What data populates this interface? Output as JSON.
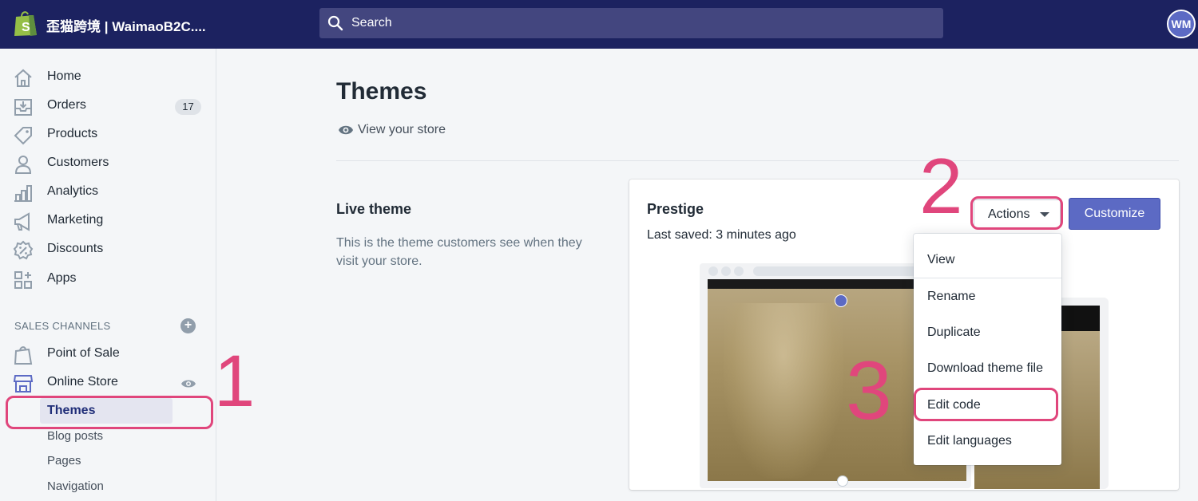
{
  "topbar": {
    "store_name": "歪猫跨境 | WaimaoB2C....",
    "search_placeholder": "Search",
    "avatar_initials": "WM"
  },
  "sidebar": {
    "items": [
      {
        "label": "Home",
        "icon": "home-icon"
      },
      {
        "label": "Orders",
        "icon": "orders-icon",
        "badge": "17"
      },
      {
        "label": "Products",
        "icon": "tag-icon"
      },
      {
        "label": "Customers",
        "icon": "person-icon"
      },
      {
        "label": "Analytics",
        "icon": "bar-chart-icon"
      },
      {
        "label": "Marketing",
        "icon": "megaphone-icon"
      },
      {
        "label": "Discounts",
        "icon": "discount-icon"
      },
      {
        "label": "Apps",
        "icon": "apps-icon"
      }
    ],
    "sales_channels_title": "SALES CHANNELS",
    "channels": [
      {
        "label": "Point of Sale",
        "icon": "pos-bag-icon"
      },
      {
        "label": "Online Store",
        "icon": "storefront-icon"
      }
    ],
    "online_store_sub": [
      "Themes",
      "Blog posts",
      "Pages",
      "Navigation"
    ]
  },
  "main": {
    "title": "Themes",
    "view_store": "View your store",
    "live_theme_title": "Live theme",
    "live_theme_desc": "This is the theme customers see when they visit your store.",
    "card": {
      "theme_name": "Prestige",
      "last_saved": "Last saved: 3 minutes ago",
      "actions_label": "Actions",
      "customize_label": "Customize"
    },
    "dropdown": [
      "View",
      "Rename",
      "Duplicate",
      "Download theme file",
      "Edit code",
      "Edit languages"
    ]
  },
  "annotations": {
    "step1": "1",
    "step2": "2",
    "step3": "3",
    "color": "#e0467c"
  },
  "colors": {
    "topbar": "#1c2260",
    "accent": "#5c6ac4",
    "active_nav_text": "#202e78"
  }
}
